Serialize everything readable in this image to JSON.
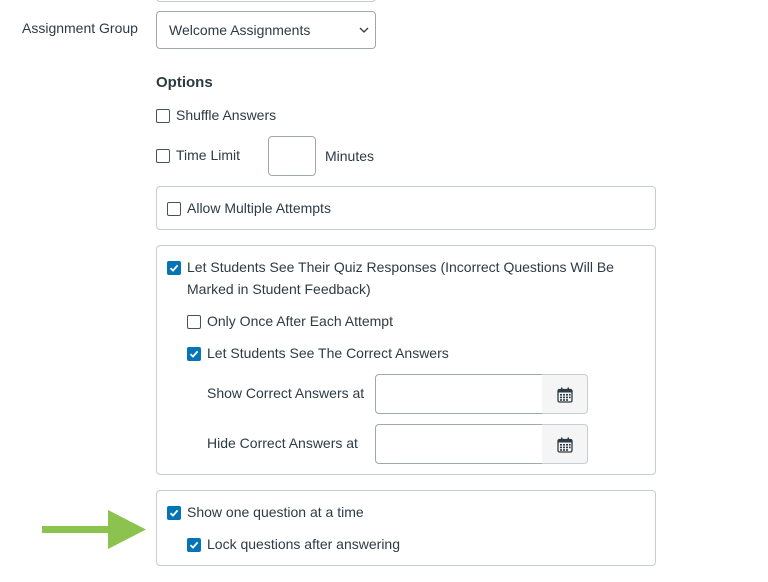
{
  "assignment_group": {
    "label": "Assignment Group",
    "selected": "Welcome Assignments"
  },
  "options": {
    "heading": "Options",
    "shuffle_answers": {
      "label": "Shuffle Answers",
      "checked": false
    },
    "time_limit": {
      "label": "Time Limit",
      "checked": false,
      "value": "",
      "unit": "Minutes"
    },
    "multiple_attempts": {
      "label": "Allow Multiple Attempts",
      "checked": false
    },
    "see_responses": {
      "label_line1": "Let Students See Their Quiz Responses (Incorrect Questions Will Be",
      "label_line2": "Marked in Student Feedback)",
      "checked": true,
      "only_once": {
        "label": "Only Once After Each Attempt",
        "checked": false
      },
      "see_correct": {
        "label": "Let Students See The Correct Answers",
        "checked": true
      },
      "show_correct_at": {
        "label": "Show Correct Answers at",
        "value": ""
      },
      "hide_correct_at": {
        "label": "Hide Correct Answers at",
        "value": ""
      }
    },
    "one_question": {
      "label": "Show one question at a time",
      "checked": true
    },
    "lock_questions": {
      "label": "Lock questions after answering",
      "checked": true
    }
  },
  "colors": {
    "accent": "#0374b5",
    "arrow": "#8cc34f",
    "border": "#c7cdd1",
    "text": "#2d3b45"
  },
  "icons": {
    "select_chevron": "chevron-down-icon",
    "calendar": "calendar-icon",
    "annotation_arrow": "arrow-right-icon"
  }
}
